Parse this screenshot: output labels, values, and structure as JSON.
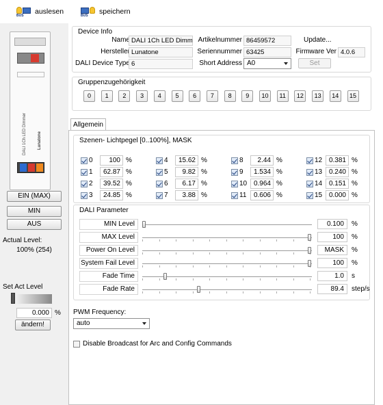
{
  "toolbar": {
    "read_label": "auslesen",
    "save_label": "speichern",
    "bus_label": "BUS"
  },
  "left": {
    "on_max": "EIN (MAX)",
    "min": "MIN",
    "off": "AUS",
    "actual_label": "Actual Level:",
    "actual_value": "100% (254)",
    "set_label": "Set Act Level",
    "set_value": "0.000",
    "set_unit": "%",
    "change_btn": "ändern!",
    "slider_fraction": 0.0,
    "device_print": "DALI 1Ch LED Dimmer",
    "device_brand": "Lunatone"
  },
  "device_info": {
    "title": "Device Info",
    "name_label": "Name",
    "name_value": "DALI 1Ch LED Dimm...",
    "article_label": "Artikelnummer",
    "article_value": "86459572",
    "update_label": "Update...",
    "maker_label": "Hersteller",
    "maker_value": "Lunatone",
    "serial_label": "Seriennummer",
    "serial_value": "63425",
    "fw_label": "Firmware Ver",
    "fw_value": "4.0.6",
    "type_label": "DALI Device Type",
    "type_value": "6",
    "short_label": "Short Address",
    "short_value": "A0",
    "set_btn": "Set"
  },
  "groups": {
    "title": "Gruppenzugehörigkeit",
    "items": [
      "0",
      "1",
      "2",
      "3",
      "4",
      "5",
      "6",
      "7",
      "8",
      "9",
      "10",
      "11",
      "12",
      "13",
      "14",
      "15"
    ]
  },
  "tab": {
    "label": "Allgemein"
  },
  "scenes": {
    "title": "Szenen- Lichtpegel [0..100%], MASK",
    "unit": "%",
    "items": [
      {
        "n": "0",
        "v": "100",
        "on": true
      },
      {
        "n": "1",
        "v": "62.87",
        "on": true
      },
      {
        "n": "2",
        "v": "39.52",
        "on": true
      },
      {
        "n": "3",
        "v": "24.85",
        "on": true
      },
      {
        "n": "4",
        "v": "15.62",
        "on": true
      },
      {
        "n": "5",
        "v": "9.82",
        "on": true
      },
      {
        "n": "6",
        "v": "6.17",
        "on": true
      },
      {
        "n": "7",
        "v": "3.88",
        "on": true
      },
      {
        "n": "8",
        "v": "2.44",
        "on": true
      },
      {
        "n": "9",
        "v": "1.534",
        "on": true
      },
      {
        "n": "10",
        "v": "0.964",
        "on": true
      },
      {
        "n": "11",
        "v": "0.606",
        "on": true
      },
      {
        "n": "12",
        "v": "0.381",
        "on": true
      },
      {
        "n": "13",
        "v": "0.240",
        "on": true
      },
      {
        "n": "14",
        "v": "0.151",
        "on": true
      },
      {
        "n": "15",
        "v": "0.000",
        "on": true
      }
    ]
  },
  "params": {
    "title": "DALI Parameter",
    "rows": [
      {
        "label": "MIN Level",
        "value": "0.100",
        "unit": "%",
        "pos": 0.0,
        "ticks": false
      },
      {
        "label": "MAX Level",
        "value": "100",
        "unit": "%",
        "pos": 1.0,
        "ticks": true
      },
      {
        "label": "Power On Level",
        "value": "MASK",
        "unit": "%",
        "pos": 1.0,
        "ticks": true
      },
      {
        "label": "System Fail Level",
        "value": "100",
        "unit": "%",
        "pos": 1.0,
        "ticks": true
      },
      {
        "label": "Fade Time",
        "value": "1.0",
        "unit": "s",
        "pos": 0.13,
        "ticks": true
      },
      {
        "label": "Fade Rate",
        "value": "89.4",
        "unit": "step/s",
        "pos": 0.33,
        "ticks": true
      }
    ]
  },
  "pwm": {
    "label": "PWM Frequency:",
    "value": "auto"
  },
  "broadcast": {
    "label": "Disable Broadcast  for Arc and Config Commands",
    "checked": false
  }
}
